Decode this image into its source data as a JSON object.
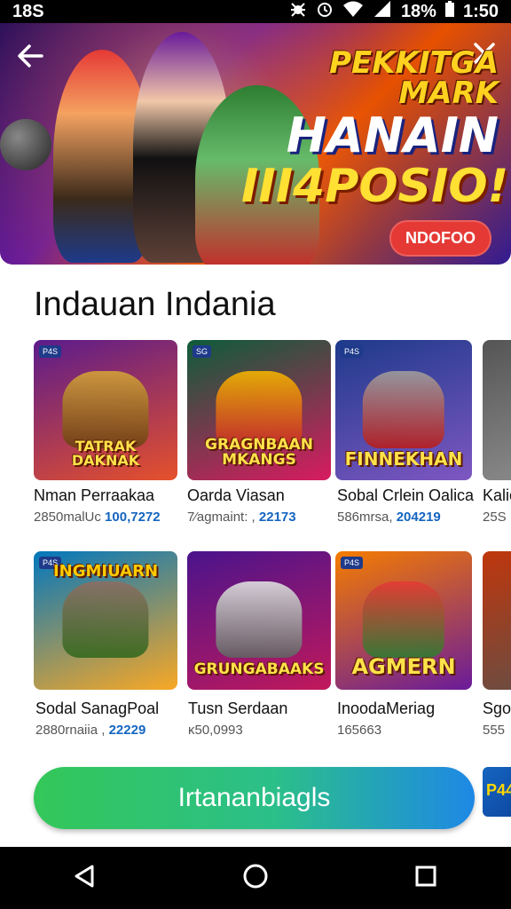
{
  "status_bar": {
    "time": "1:50",
    "left_text": "18S",
    "battery": "18%"
  },
  "banner": {
    "title_line1": "PEKKITGA MARK",
    "title_line2": "HANAIN",
    "title_line3": "III4POSIO!",
    "badge": "NDOFOO",
    "back_icon": "arrow-left-icon",
    "close_icon": "close-icon"
  },
  "section": {
    "title": "Indauan Indania"
  },
  "games_row1": [
    {
      "art_title": "TATRAK DAKNAK",
      "name": "Nman Perraakaa",
      "stat_prefix": "2850malUc",
      "stat_value": "100,7272",
      "badge": "P4S",
      "colors": [
        "#5b1b8c",
        "#e6512b"
      ]
    },
    {
      "art_title": "GRAGNBAAN MKANGS",
      "name": "Oarda Viasan",
      "stat_prefix": "7⁄agmaint: ,",
      "stat_value": "22173",
      "badge": "SG",
      "colors": [
        "#0d5c3a",
        "#d81b60"
      ]
    },
    {
      "art_title": "FINNEKHAN",
      "name": "Sobal Crlein Oalica",
      "stat_prefix": "586mrsa,",
      "stat_value": "204219",
      "badge": "P4S",
      "colors": [
        "#1e3a8a",
        "#7e57c2"
      ]
    },
    {
      "art_title": "",
      "name": "Kalic",
      "stat_prefix": "25S",
      "stat_value": "",
      "badge": "",
      "colors": [
        "#555",
        "#888"
      ]
    }
  ],
  "games_row2": [
    {
      "art_title": "INGMIUARN",
      "name": "Sodal SanagPoal",
      "stat_prefix": "2880rnaiia ,",
      "stat_value": "22229",
      "badge": "P4S",
      "colors": [
        "#0277bd",
        "#f9a825"
      ]
    },
    {
      "art_title": "GRUNGABAAKS",
      "name": "Tusn Serdaan",
      "stat_prefix": "ĸ50,0993",
      "stat_value": "",
      "badge": "",
      "colors": [
        "#4a148c",
        "#c2185b"
      ]
    },
    {
      "art_title": "AGMERN",
      "name": "InoodaMeriag",
      "stat_prefix": "165663",
      "stat_value": "",
      "badge": "P4S",
      "colors": [
        "#f57c00",
        "#6a1b9a"
      ]
    },
    {
      "art_title": "",
      "name": "Sgo",
      "stat_prefix": "555",
      "stat_value": "",
      "badge": "",
      "colors": [
        "#bf360c",
        "#6d4c41"
      ]
    }
  ],
  "cta": {
    "label": "Irtananbiagls"
  },
  "side_thumb": {
    "label": "P44"
  },
  "nav": {
    "back": "back-triangle-icon",
    "home": "home-circle-icon",
    "recents": "recents-square-icon"
  }
}
